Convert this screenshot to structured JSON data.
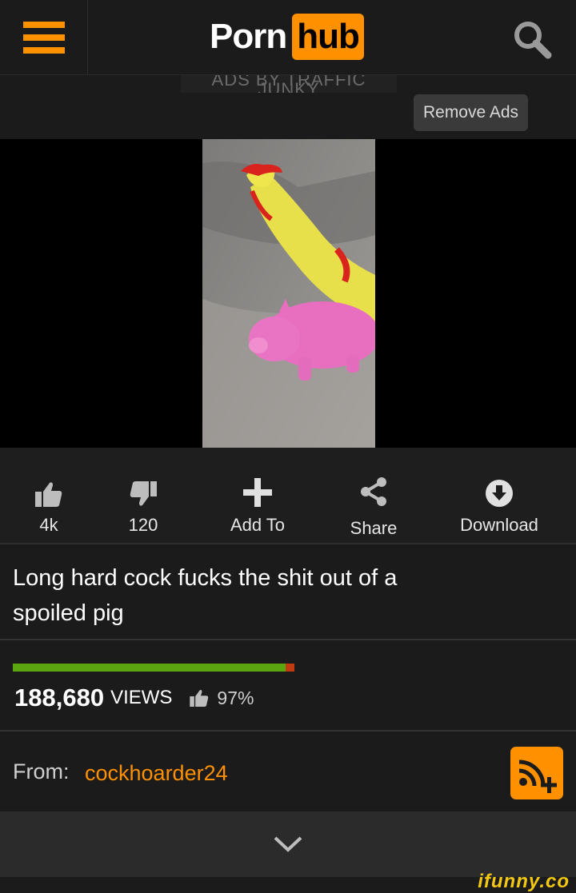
{
  "header": {
    "logo_part1": "Porn",
    "logo_part2": "hub"
  },
  "ad": {
    "label": "ADS BY TRAFFIC JUNKY",
    "remove_label": "Remove Ads"
  },
  "actions": {
    "likes": "4k",
    "dislikes": "120",
    "add_to": "Add To",
    "share": "Share",
    "download": "Download"
  },
  "video": {
    "title": "Long hard cock fucks the shit out of a spoiled pig"
  },
  "stats": {
    "views_count": "188,680",
    "views_word": "VIEWS",
    "rating_percent": "97%",
    "rating_fraction": 0.97
  },
  "channel": {
    "from_label": "From:",
    "username": "cockhoarder24"
  },
  "watermark": "ifunny.co",
  "colors": {
    "accent": "#ff9000",
    "rating_good": "#5ba511",
    "rating_bad": "#c23a10",
    "background": "#1b1b1b"
  },
  "icons": [
    "menu-icon",
    "search-icon",
    "thumbs-up-icon",
    "thumbs-down-icon",
    "plus-icon",
    "share-icon",
    "download-icon",
    "rss-subscribe-icon",
    "chevron-down-icon"
  ]
}
